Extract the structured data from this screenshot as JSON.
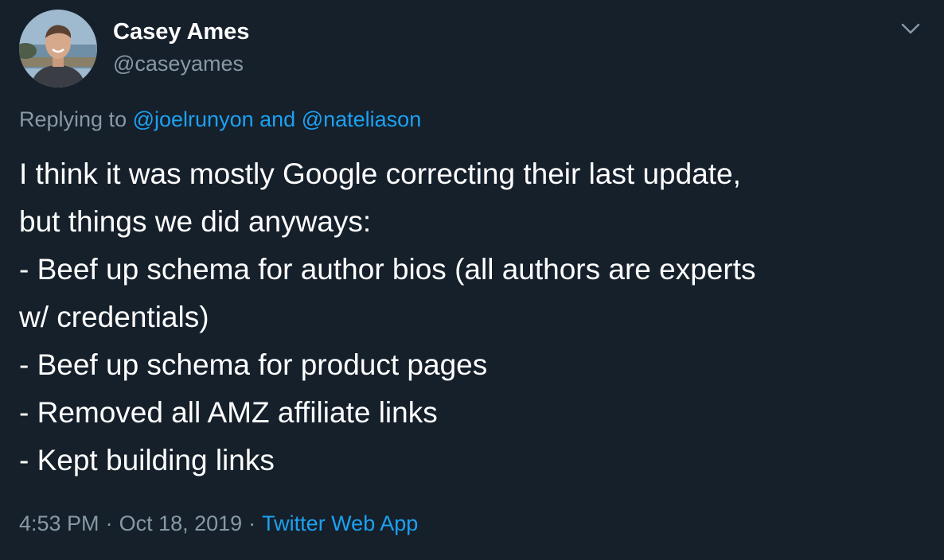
{
  "theme": {
    "background": "#15202b",
    "text_primary": "#ffffff",
    "text_secondary": "#8899a6",
    "link": "#1da1f2"
  },
  "author": {
    "display_name": "Casey Ames",
    "handle": "@caseyames"
  },
  "reply": {
    "prefix": "Replying to",
    "mention_1": "@joelrunyon",
    "conjunction": "and",
    "mention_2": "@nateliason"
  },
  "tweet": {
    "lines": [
      "I think it was mostly Google correcting their last update,",
      "but things we did anyways:",
      "- Beef up schema for author bios (all authors are experts",
      "w/ credentials)",
      "- Beef up schema for product pages",
      "- Removed all AMZ affiliate links",
      "- Kept building links"
    ]
  },
  "meta": {
    "time": "4:53 PM",
    "separator": "·",
    "date": "Oct 18, 2019",
    "source": "Twitter Web App"
  },
  "icons": {
    "menu": "chevron-down-icon",
    "avatar": "user-photo"
  }
}
